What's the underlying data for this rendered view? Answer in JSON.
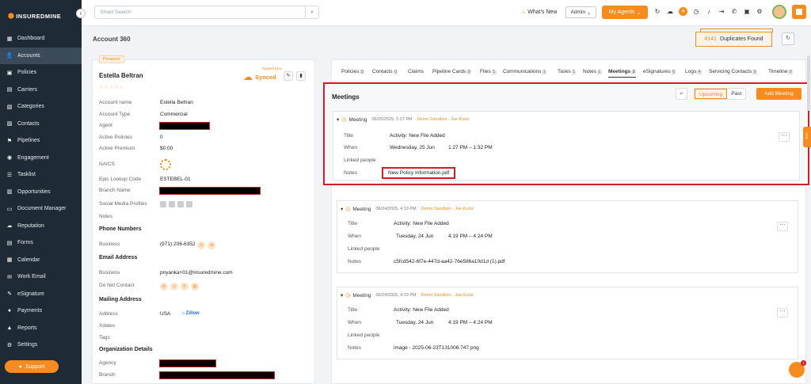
{
  "brand": {
    "name": "INSUREDMINE"
  },
  "sidebar": {
    "items": [
      {
        "label": "Dashboard",
        "icon": "dashboard-icon",
        "glyph": "▦"
      },
      {
        "label": "Accounts",
        "icon": "accounts-icon",
        "glyph": "👤"
      },
      {
        "label": "Policies",
        "icon": "policies-icon",
        "glyph": "▣"
      },
      {
        "label": "Carriers",
        "icon": "carriers-icon",
        "glyph": "▤"
      },
      {
        "label": "Categories",
        "icon": "categories-icon",
        "glyph": "▧"
      },
      {
        "label": "Contacts",
        "icon": "contacts-icon",
        "glyph": "▨"
      },
      {
        "label": "Pipelines",
        "icon": "pipelines-icon",
        "glyph": "⚑"
      },
      {
        "label": "Engagement",
        "icon": "engagement-icon",
        "glyph": "◉"
      },
      {
        "label": "Tasklist",
        "icon": "tasklist-icon",
        "glyph": "☰"
      },
      {
        "label": "Opportunities",
        "icon": "opportunities-icon",
        "glyph": "▥"
      },
      {
        "label": "Document Manager",
        "icon": "folder-icon",
        "glyph": "▭"
      },
      {
        "label": "Reputation",
        "icon": "reputation-icon",
        "glyph": "☁"
      },
      {
        "label": "Forms",
        "icon": "forms-icon",
        "glyph": "▤"
      },
      {
        "label": "Calendar",
        "icon": "calendar-icon",
        "glyph": "▦"
      },
      {
        "label": "Work Email",
        "icon": "email-icon",
        "glyph": "✉"
      },
      {
        "label": "eSignature",
        "icon": "esignature-icon",
        "glyph": "✎"
      },
      {
        "label": "Payments",
        "icon": "payments-icon",
        "glyph": "●"
      },
      {
        "label": "Reports",
        "icon": "reports-icon",
        "glyph": "▲"
      },
      {
        "label": "Settings",
        "icon": "settings-icon",
        "glyph": "⚙"
      }
    ],
    "active_index": 1,
    "support_label": "Support"
  },
  "topbar": {
    "search_placeholder": "Smart Search",
    "whats_new": "What's New",
    "admin": "Admin",
    "my_agents": "My Agents"
  },
  "account": {
    "title": "Account 360",
    "duplicates_count": "#141",
    "duplicates_label": "Duplicates Found"
  },
  "profile": {
    "status": "Prospect",
    "name": "Estella Beltran",
    "sync_small": "Applied Epic",
    "sync": "Synced",
    "account_name_label": "Account name",
    "account_name": "Estella Beltran",
    "account_type_label": "Account Type",
    "account_type": "Commercial",
    "agent_label": "Agent",
    "active_policies_label": "Active Policies",
    "active_policies": "0",
    "active_premium_label": "Active Premium",
    "active_premium": "$0.00",
    "naics_label": "NAICS",
    "epic_label": "Epic Lookup Code",
    "epic": "ESTEBEL-01",
    "branch_name_label": "Branch Name",
    "social_label": "Social Media Profiles",
    "notes_label": "Notes",
    "phone_section": "Phone Numbers",
    "business_label": "Business",
    "business_phone": "(971) 206-6352",
    "email_section": "Email Address",
    "business_email": "pnyanka+01@insuredmine.com",
    "dnc_label": "Do Not Contact",
    "mailing_section": "Mailing Address",
    "address_label": "Address",
    "address": "USA",
    "zillow": "Zillow",
    "xdates_label": "Xdates",
    "tags_label": "Tags",
    "org_section": "Organization Details",
    "agency_label": "Agency",
    "branch_label": "Branch"
  },
  "tabs": [
    {
      "label": "Policies",
      "count": "0"
    },
    {
      "label": "Contacts",
      "count": "0"
    },
    {
      "label": "Claims",
      "count": ""
    },
    {
      "label": "Pipeline Cards",
      "count": "0"
    },
    {
      "label": "Files",
      "count": "1"
    },
    {
      "label": "Communications",
      "count": "1"
    },
    {
      "label": "Tasks",
      "count": "1"
    },
    {
      "label": "Notes",
      "count": "1"
    },
    {
      "label": "Meetings",
      "count": "3"
    },
    {
      "label": "eSignatures",
      "count": "0"
    },
    {
      "label": "Logs",
      "count": "4"
    },
    {
      "label": "Servicing Contacts",
      "count": "0"
    },
    {
      "label": "Timeline",
      "count": "0"
    }
  ],
  "meetings": {
    "title": "Meetings",
    "upcoming": "Upcoming",
    "past": "Past",
    "add": "Add Meeting",
    "labels": {
      "title": "Title",
      "when": "When",
      "linked": "Linked people",
      "notes": "Notes"
    },
    "items": [
      {
        "type": "Meeting",
        "date": "06/25/2025, 1:27 PM",
        "by": "Demo Sandbox - Joe Kurtz",
        "title": "Activity: New File Added",
        "day": "Wednesday, 25 Jun",
        "time": "1:27 PM – 1:32 PM",
        "notes": "New Policy Information.pdf"
      },
      {
        "type": "Meeting",
        "date": "06/24/2025, 4:19 PM",
        "by": "Demo Sandbox - Joe Kurtz",
        "title": "Activity: New File Added",
        "day": "Tuesday, 24 Jun",
        "time": "4:19 PM – 4:24 PM",
        "notes": "c5fcd542-6f7e-447d-aa42-76e586a10d1d (1).pdf"
      },
      {
        "type": "Meeting",
        "date": "06/24/2025, 4:19 PM",
        "by": "Demo Sandbox - Joe Kurtz",
        "title": "Activity: New File Added",
        "day": "Tuesday, 24 Jun",
        "time": "4:19 PM – 4:24 PM",
        "notes": "image - 2025-06-23T131006.747.png"
      }
    ]
  },
  "help_tab": "Help",
  "chat_badge": "1",
  "colors": {
    "accent": "#f68b1f",
    "sidebar": "#1e2a36",
    "highlight": "#d01e24"
  }
}
